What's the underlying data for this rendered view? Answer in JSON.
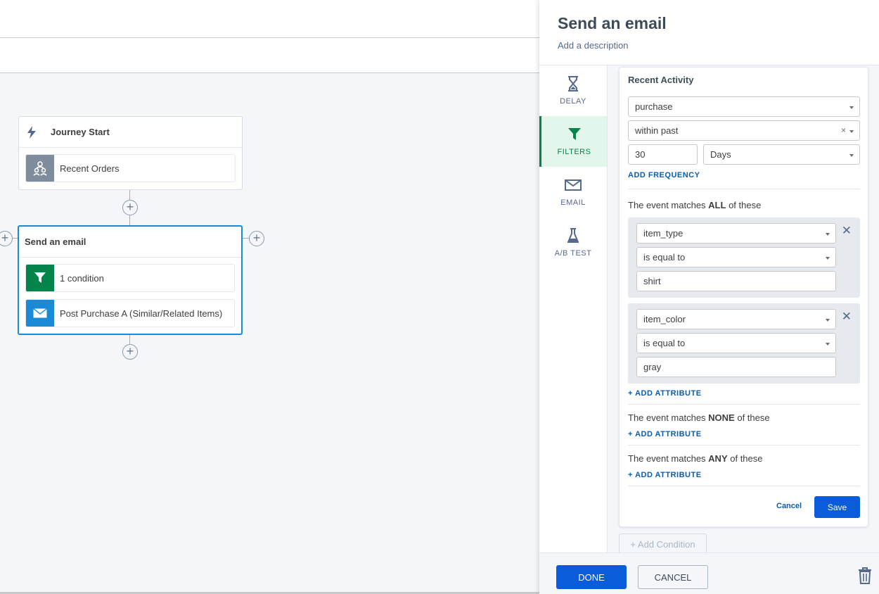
{
  "canvas": {
    "start_node": {
      "title": "Journey Start",
      "icon": "bolt-icon",
      "row_label": "Recent Orders",
      "row_icon": "audience-icon"
    },
    "email_node": {
      "title": "Send an email",
      "condition_label": "1 condition",
      "condition_icon": "filter-icon",
      "email_label": "Post Purchase A (Similar/Related Items)",
      "email_icon": "envelope-icon"
    }
  },
  "panel": {
    "title": "Send an email",
    "description": "Add a description",
    "nav": [
      {
        "label": "DELAY",
        "icon": "hourglass-icon"
      },
      {
        "label": "FILTERS",
        "icon": "filter-icon"
      },
      {
        "label": "EMAIL",
        "icon": "envelope-icon"
      },
      {
        "label": "A/B TEST",
        "icon": "flask-icon"
      }
    ],
    "card": {
      "title": "Recent Activity",
      "event": "purchase",
      "timeframe": "within past",
      "amount": "30",
      "unit": "Days",
      "add_frequency": "ADD FREQUENCY",
      "all_prefix": "The event matches ",
      "all_keyword": "ALL",
      "all_suffix": " of these",
      "conditions": [
        {
          "attribute": "item_type",
          "operator": "is equal to",
          "value": "shirt"
        },
        {
          "attribute": "item_color",
          "operator": "is equal to",
          "value": "gray"
        }
      ],
      "add_attribute": "+ ADD ATTRIBUTE",
      "none_prefix": "The event matches ",
      "none_keyword": "NONE",
      "none_suffix": " of these",
      "any_prefix": "The event matches ",
      "any_keyword": "ANY",
      "any_suffix": " of these",
      "cancel": "Cancel",
      "save": "Save"
    },
    "add_condition": "+ Add Condition",
    "done": "DONE",
    "cancel": "CANCEL"
  },
  "colors": {
    "accent": "#0b5cdb",
    "filter_green": "#04844b",
    "selected_border": "#1b8ad6"
  }
}
